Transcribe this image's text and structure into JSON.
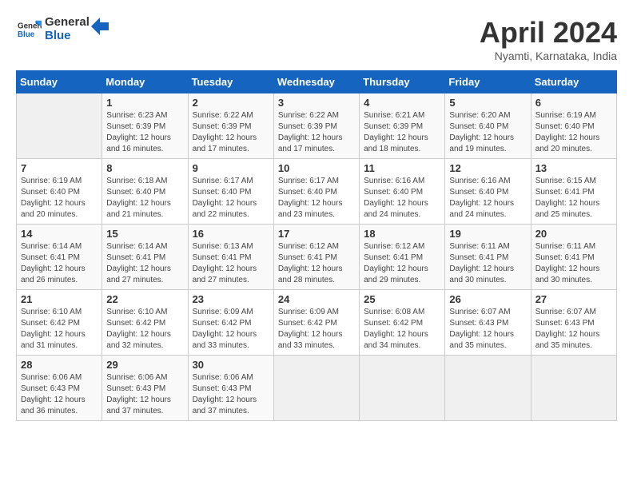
{
  "header": {
    "logo_general": "General",
    "logo_blue": "Blue",
    "month_title": "April 2024",
    "location": "Nyamti, Karnataka, India"
  },
  "days_of_week": [
    "Sunday",
    "Monday",
    "Tuesday",
    "Wednesday",
    "Thursday",
    "Friday",
    "Saturday"
  ],
  "weeks": [
    [
      {
        "day": "",
        "info": ""
      },
      {
        "day": "1",
        "info": "Sunrise: 6:23 AM\nSunset: 6:39 PM\nDaylight: 12 hours\nand 16 minutes."
      },
      {
        "day": "2",
        "info": "Sunrise: 6:22 AM\nSunset: 6:39 PM\nDaylight: 12 hours\nand 17 minutes."
      },
      {
        "day": "3",
        "info": "Sunrise: 6:22 AM\nSunset: 6:39 PM\nDaylight: 12 hours\nand 17 minutes."
      },
      {
        "day": "4",
        "info": "Sunrise: 6:21 AM\nSunset: 6:39 PM\nDaylight: 12 hours\nand 18 minutes."
      },
      {
        "day": "5",
        "info": "Sunrise: 6:20 AM\nSunset: 6:40 PM\nDaylight: 12 hours\nand 19 minutes."
      },
      {
        "day": "6",
        "info": "Sunrise: 6:19 AM\nSunset: 6:40 PM\nDaylight: 12 hours\nand 20 minutes."
      }
    ],
    [
      {
        "day": "7",
        "info": "Sunrise: 6:19 AM\nSunset: 6:40 PM\nDaylight: 12 hours\nand 20 minutes."
      },
      {
        "day": "8",
        "info": "Sunrise: 6:18 AM\nSunset: 6:40 PM\nDaylight: 12 hours\nand 21 minutes."
      },
      {
        "day": "9",
        "info": "Sunrise: 6:17 AM\nSunset: 6:40 PM\nDaylight: 12 hours\nand 22 minutes."
      },
      {
        "day": "10",
        "info": "Sunrise: 6:17 AM\nSunset: 6:40 PM\nDaylight: 12 hours\nand 23 minutes."
      },
      {
        "day": "11",
        "info": "Sunrise: 6:16 AM\nSunset: 6:40 PM\nDaylight: 12 hours\nand 24 minutes."
      },
      {
        "day": "12",
        "info": "Sunrise: 6:16 AM\nSunset: 6:40 PM\nDaylight: 12 hours\nand 24 minutes."
      },
      {
        "day": "13",
        "info": "Sunrise: 6:15 AM\nSunset: 6:41 PM\nDaylight: 12 hours\nand 25 minutes."
      }
    ],
    [
      {
        "day": "14",
        "info": "Sunrise: 6:14 AM\nSunset: 6:41 PM\nDaylight: 12 hours\nand 26 minutes."
      },
      {
        "day": "15",
        "info": "Sunrise: 6:14 AM\nSunset: 6:41 PM\nDaylight: 12 hours\nand 27 minutes."
      },
      {
        "day": "16",
        "info": "Sunrise: 6:13 AM\nSunset: 6:41 PM\nDaylight: 12 hours\nand 27 minutes."
      },
      {
        "day": "17",
        "info": "Sunrise: 6:12 AM\nSunset: 6:41 PM\nDaylight: 12 hours\nand 28 minutes."
      },
      {
        "day": "18",
        "info": "Sunrise: 6:12 AM\nSunset: 6:41 PM\nDaylight: 12 hours\nand 29 minutes."
      },
      {
        "day": "19",
        "info": "Sunrise: 6:11 AM\nSunset: 6:41 PM\nDaylight: 12 hours\nand 30 minutes."
      },
      {
        "day": "20",
        "info": "Sunrise: 6:11 AM\nSunset: 6:41 PM\nDaylight: 12 hours\nand 30 minutes."
      }
    ],
    [
      {
        "day": "21",
        "info": "Sunrise: 6:10 AM\nSunset: 6:42 PM\nDaylight: 12 hours\nand 31 minutes."
      },
      {
        "day": "22",
        "info": "Sunrise: 6:10 AM\nSunset: 6:42 PM\nDaylight: 12 hours\nand 32 minutes."
      },
      {
        "day": "23",
        "info": "Sunrise: 6:09 AM\nSunset: 6:42 PM\nDaylight: 12 hours\nand 33 minutes."
      },
      {
        "day": "24",
        "info": "Sunrise: 6:09 AM\nSunset: 6:42 PM\nDaylight: 12 hours\nand 33 minutes."
      },
      {
        "day": "25",
        "info": "Sunrise: 6:08 AM\nSunset: 6:42 PM\nDaylight: 12 hours\nand 34 minutes."
      },
      {
        "day": "26",
        "info": "Sunrise: 6:07 AM\nSunset: 6:43 PM\nDaylight: 12 hours\nand 35 minutes."
      },
      {
        "day": "27",
        "info": "Sunrise: 6:07 AM\nSunset: 6:43 PM\nDaylight: 12 hours\nand 35 minutes."
      }
    ],
    [
      {
        "day": "28",
        "info": "Sunrise: 6:06 AM\nSunset: 6:43 PM\nDaylight: 12 hours\nand 36 minutes."
      },
      {
        "day": "29",
        "info": "Sunrise: 6:06 AM\nSunset: 6:43 PM\nDaylight: 12 hours\nand 37 minutes."
      },
      {
        "day": "30",
        "info": "Sunrise: 6:06 AM\nSunset: 6:43 PM\nDaylight: 12 hours\nand 37 minutes."
      },
      {
        "day": "",
        "info": ""
      },
      {
        "day": "",
        "info": ""
      },
      {
        "day": "",
        "info": ""
      },
      {
        "day": "",
        "info": ""
      }
    ]
  ]
}
